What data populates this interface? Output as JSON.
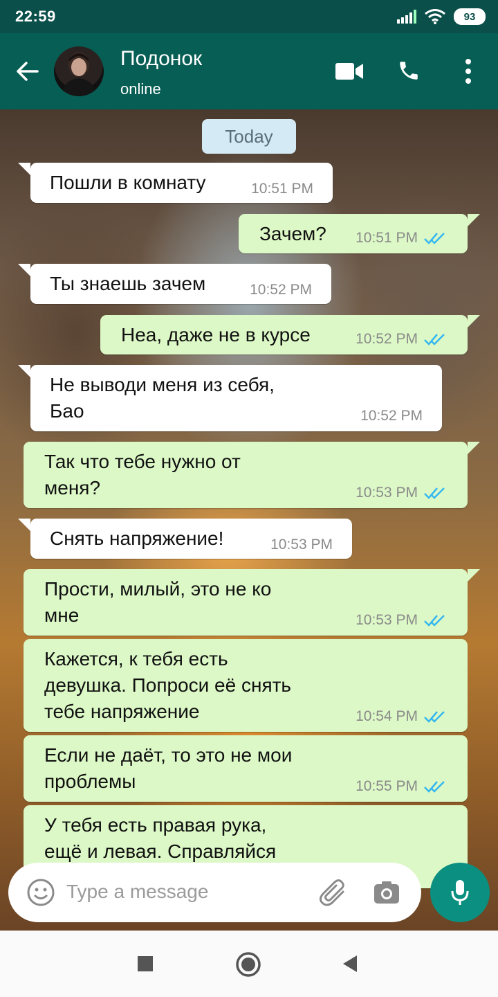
{
  "status_bar": {
    "time": "22:59",
    "battery": "93"
  },
  "header": {
    "contact_name": "Подонок",
    "contact_status": "online"
  },
  "chat": {
    "date_label": "Today",
    "messages": [
      {
        "dir": "in",
        "text": "Пошли в комнату",
        "time": "10:51 PM"
      },
      {
        "dir": "out",
        "text": "Зачем?",
        "time": "10:51 PM",
        "read": true
      },
      {
        "dir": "in",
        "text": "Ты знаешь зачем",
        "time": "10:52 PM"
      },
      {
        "dir": "out",
        "text": "Неа, даже не в курсе",
        "time": "10:52 PM",
        "read": true
      },
      {
        "dir": "in",
        "text": "Не выводи меня из себя,\nБао",
        "time": "10:52 PM"
      },
      {
        "dir": "out",
        "text": "Так что тебе нужно от\nменя?",
        "time": "10:53 PM",
        "read": true
      },
      {
        "dir": "in",
        "text": "Снять напряжение!",
        "time": "10:53 PM"
      },
      {
        "dir": "out",
        "text": "Прости, милый, это не ко\nмне",
        "time": "10:53 PM",
        "read": true
      },
      {
        "dir": "out",
        "text": "Кажется, к тебя есть\nдевушка. Попроси её снять\nтебе напряжение",
        "time": "10:54 PM",
        "read": true
      },
      {
        "dir": "out",
        "text": "Если не даёт, то это не мои\nпроблемы",
        "time": "10:55 PM",
        "read": true
      },
      {
        "dir": "out",
        "text": "У тебя есть правая рука,\nещё и левая. Справляйся",
        "time": ""
      }
    ]
  },
  "input": {
    "placeholder": "Type a message"
  },
  "colors": {
    "header": "#075e54",
    "status_bar": "#0b4f4a",
    "outgoing_bubble": "#dcf8c6",
    "incoming_bubble": "#ffffff",
    "read_ticks": "#34b7f1",
    "mic_button": "#0a8f80"
  },
  "icons": [
    "back-arrow-icon",
    "video-call-icon",
    "phone-icon",
    "more-vert-icon",
    "emoji-icon",
    "attach-icon",
    "camera-icon",
    "mic-icon",
    "nav-recents-icon",
    "nav-home-icon",
    "nav-back-icon"
  ]
}
